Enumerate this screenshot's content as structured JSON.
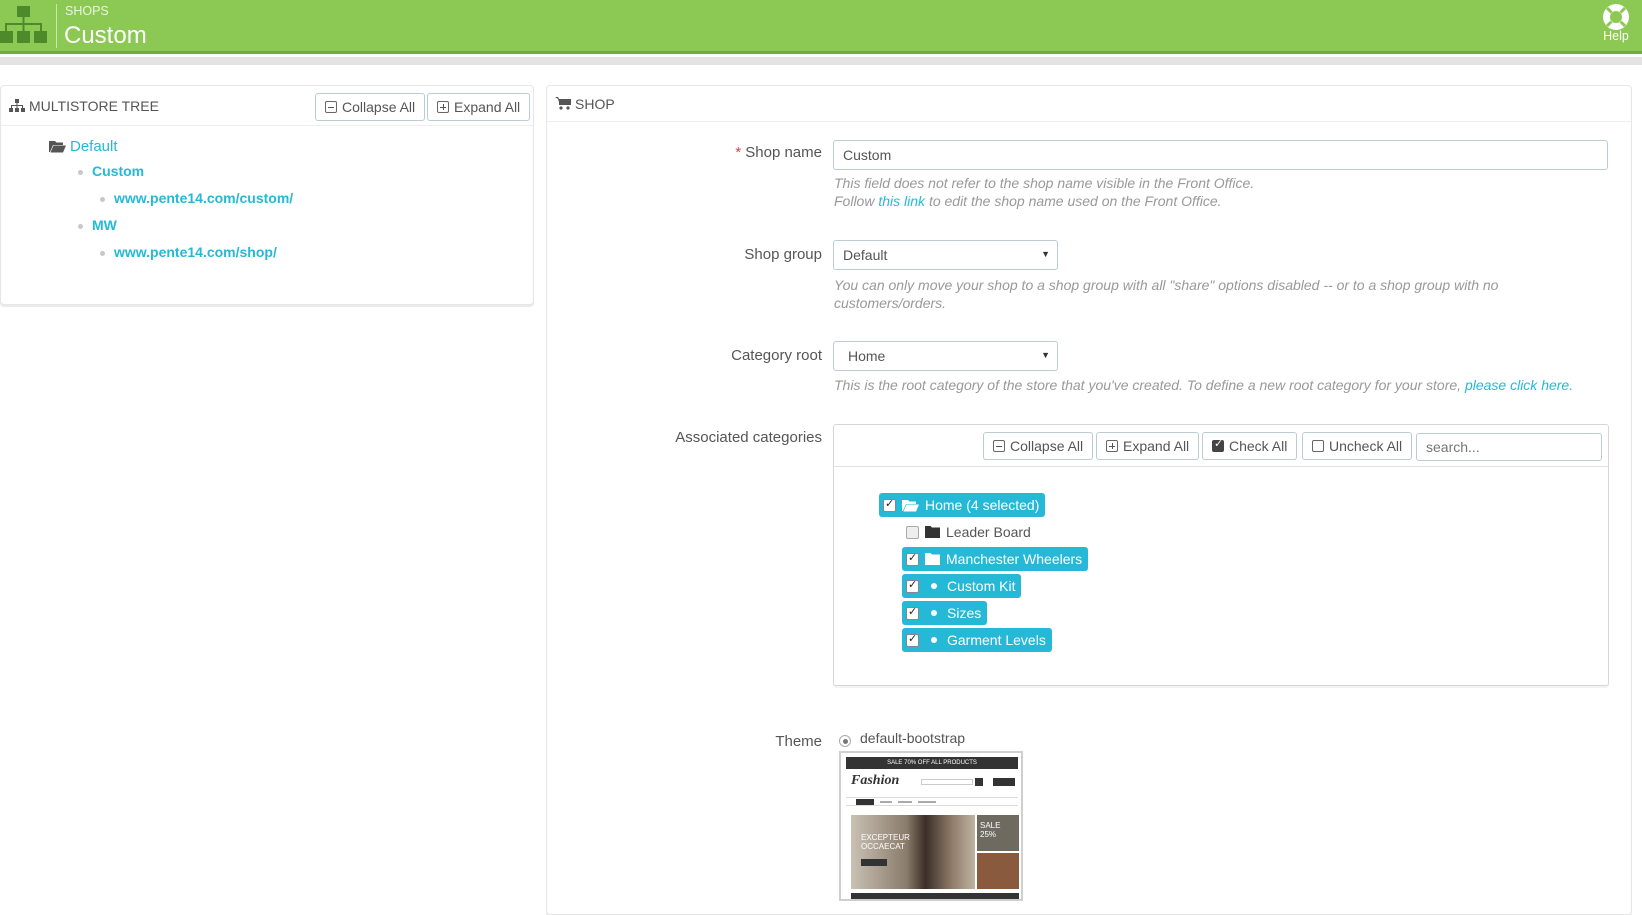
{
  "header": {
    "breadcrumb": "SHOPS",
    "title": "Custom",
    "help_label": "Help",
    "accent_color": "#8bc954"
  },
  "tree_panel": {
    "title": "MULTISTORE TREE",
    "collapse_label": "Collapse All",
    "expand_label": "Expand All",
    "group": "Default",
    "shops": [
      {
        "name": "Custom",
        "url": "www.pente14.com/custom/"
      },
      {
        "name": "MW",
        "url": "www.pente14.com/shop/"
      }
    ]
  },
  "shop_panel": {
    "title": "SHOP",
    "shop_name": {
      "label": "Shop name",
      "required_mark": "*",
      "value": "Custom",
      "help_line1": "This field does not refer to the shop name visible in the Front Office.",
      "help_follow": "Follow",
      "help_link": "this link",
      "help_rest": "to edit the shop name used on the Front Office."
    },
    "shop_group": {
      "label": "Shop group",
      "value": "Default",
      "help_line1": "You can only move your shop to a shop group with all \"share\" options disabled -- or to a shop group with no",
      "help_line2": "customers/orders."
    },
    "category_root": {
      "label": "Category root",
      "value": "Home",
      "help_text": "This is the root category of the store that you've created. To define a new root category for your store,",
      "help_link": "please click here."
    },
    "associated_categories": {
      "label": "Associated categories",
      "collapse_label": "Collapse All",
      "expand_label": "Expand All",
      "check_label": "Check All",
      "uncheck_label": "Uncheck All",
      "search_placeholder": "search...",
      "items": [
        {
          "label": "Home (4 selected)",
          "checked": true,
          "icon": "folder-open-icon"
        },
        {
          "label": "Leader Board",
          "checked": false,
          "icon": "folder-icon"
        },
        {
          "label": "Manchester Wheelers",
          "checked": true,
          "icon": "folder-icon"
        },
        {
          "label": "Custom Kit",
          "checked": true,
          "icon": "bullet-icon"
        },
        {
          "label": "Sizes",
          "checked": true,
          "icon": "bullet-icon"
        },
        {
          "label": "Garment Levels",
          "checked": true,
          "icon": "bullet-icon"
        }
      ]
    },
    "theme": {
      "label": "Theme",
      "option": "default-bootstrap",
      "preview_brand": "Fashion",
      "preview_banner": "SALE 70% OFF ALL PRODUCTS",
      "preview_hero": "EXCEPTEUR OCCAECAT",
      "preview_sale": "SALE 25%"
    }
  }
}
